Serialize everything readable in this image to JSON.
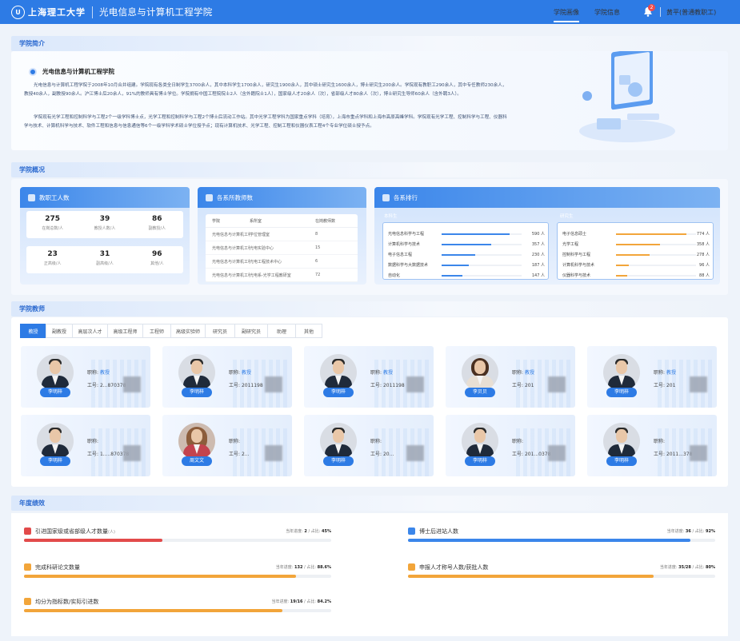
{
  "header": {
    "logo_glyph": "U",
    "university": "上海理工大学",
    "college": "光电信息与计算机工程学院",
    "nav": [
      {
        "label": "学院画像",
        "active": true
      },
      {
        "label": "学院信息",
        "active": false
      }
    ],
    "notification_count": "2",
    "user": "黄平(普通教职工)"
  },
  "intro": {
    "section_title": "学院简介",
    "college_name": "光电信息与计算机工程学院",
    "paragraphs": [
      "光电信息与计算机工程学院于2008年10月合并组建。学院现有各类全日制学生3700余人，其中本科学生1700余人，研究生1900余人，其中硕士研究生1600余人，博士研究生200余人。学院现有教职工290余人，其中专任教师230余人，教授40余人，副教授90余人。沪江博士后20余人，91%的教师具有博士学位。学院拥有中国工程院院士2人（含外籍院士1人），国家级人才20余人（次），省部级人才80余人（次），博士研究生导师60余人（含外聘3人）。",
      "学院现有光学工程和控制科学与工程2个一级学科博士点，光学工程和控制科学与工程2个博士后流动工作站。其中光学工程学科为国家重点学科（培育），上海市重点学科和上海市高原高峰学科。学院现有光学工程、控制科学与工程、仪器科学与技术、计算机科学与技术、软件工程和信息与信息通信等6个一级学科学术硕士学位授予点；现有计算机技术、光学工程、控制工程和仪器仪表工程4个专业学位硕士授予点。"
    ]
  },
  "overview": {
    "section_title": "学院概况",
    "staff_card": {
      "title": "教职工人数",
      "stats": [
        {
          "value": "275",
          "label": "在岗总数/人"
        },
        {
          "value": "39",
          "label": "教授人数/人"
        },
        {
          "value": "86",
          "label": "副教授/人"
        },
        {
          "value": "23",
          "label": "正高级/人"
        },
        {
          "value": "31",
          "label": "副高级/人"
        },
        {
          "value": "96",
          "label": "其他/人"
        }
      ]
    },
    "dept_card": {
      "title": "各系所教师数",
      "headers": [
        "学院",
        "系所室",
        "在岗教师数"
      ],
      "rows": [
        [
          "光电信息与计算机工程学院",
          "学位管理室",
          "8"
        ],
        [
          "光电信息与计算机工程学院",
          "光电实验中心",
          "15"
        ],
        [
          "光电信息与计算机工程学院",
          "光电工程技术中心",
          "6"
        ],
        [
          "光电信息与计算机工程学院",
          "光电系-光学工程教研室",
          "72"
        ]
      ]
    },
    "rank_card": {
      "title": "各系排行",
      "groups": [
        {
          "label": "本科生",
          "color": "#3b86ea",
          "items": [
            {
              "name": "光电信息科学与工程",
              "value": "590 人",
              "ratio": 0.85
            },
            {
              "name": "计算机科学与技术",
              "value": "357 人",
              "ratio": 0.62
            },
            {
              "name": "电子信息工程",
              "value": "230 人",
              "ratio": 0.42
            },
            {
              "name": "数据科学与大数据技术",
              "value": "187 人",
              "ratio": 0.34
            },
            {
              "name": "自动化",
              "value": "147 人",
              "ratio": 0.26
            }
          ]
        },
        {
          "label": "研究生",
          "color": "#f2a53a",
          "items": [
            {
              "name": "电子信息硕士",
              "value": "774 人",
              "ratio": 0.88
            },
            {
              "name": "光学工程",
              "value": "358 人",
              "ratio": 0.55
            },
            {
              "name": "控制科学与工程",
              "value": "278 人",
              "ratio": 0.42
            },
            {
              "name": "计算机科学与技术",
              "value": "96 人",
              "ratio": 0.16
            },
            {
              "name": "仪器科学与技术",
              "value": "88 人",
              "ratio": 0.14
            }
          ]
        }
      ]
    }
  },
  "teachers": {
    "section_title": "学院教师",
    "tabs": [
      "教授",
      "副教授",
      "高层次人才",
      "高级工程师",
      "工程师",
      "高级实验师",
      "研究员",
      "副研究员",
      "助理",
      "其他"
    ],
    "title_label": "职称:",
    "id_label": "工号:",
    "cards": [
      {
        "name": "李明梓",
        "title": "教授",
        "id": "2...870378",
        "avatar": "male"
      },
      {
        "name": "李明梓",
        "title": "教授",
        "id": "2011198",
        "avatar": "male"
      },
      {
        "name": "李明梓",
        "title": "教授",
        "id": "2011198",
        "avatar": "male"
      },
      {
        "name": "李贝贝",
        "title": "教授",
        "id": "201",
        "avatar": "female"
      },
      {
        "name": "李明梓",
        "title": "教授",
        "id": "201",
        "avatar": "male"
      },
      {
        "name": "李明梓",
        "title": "",
        "id": "1.....870378",
        "avatar": "male"
      },
      {
        "name": "周文文",
        "title": "",
        "id": "2...",
        "avatar": "female2"
      },
      {
        "name": "李明梓",
        "title": "",
        "id": "20...",
        "avatar": "male"
      },
      {
        "name": "李明梓",
        "title": "",
        "id": "201...0378",
        "avatar": "male"
      },
      {
        "name": "李明梓",
        "title": "",
        "id": "2011...378",
        "avatar": "male"
      }
    ]
  },
  "performance": {
    "section_title": "年度绩效",
    "progress_label": "当年进度:",
    "ratio_label": "占比:",
    "items": [
      {
        "title": "引进国家级或省部级人才数量",
        "suffix": "(人)",
        "progress": "2",
        "ratio": "45%",
        "fill": 0.45,
        "color": "#e24a4a",
        "icon": "person-icon"
      },
      {
        "title": "博士后进站人数",
        "suffix": "",
        "progress": "36",
        "ratio": "92%",
        "fill": 0.92,
        "color": "#3b86ea",
        "icon": "flask-icon"
      },
      {
        "title": "完成科研论文数量",
        "suffix": "",
        "progress": "132",
        "ratio": "88.6%",
        "fill": 0.886,
        "color": "#f2a53a",
        "icon": "document-icon"
      },
      {
        "title": "申报人才称号人数/获批人数",
        "suffix": "",
        "progress": "35/28",
        "ratio": "80%",
        "fill": 0.8,
        "color": "#f2a53a",
        "icon": "person-icon"
      },
      {
        "title": "均分为指标数/实际引进数",
        "suffix": "",
        "progress": "19/16",
        "ratio": "84.2%",
        "fill": 0.842,
        "color": "#f2a53a",
        "icon": "chart-icon"
      }
    ]
  }
}
